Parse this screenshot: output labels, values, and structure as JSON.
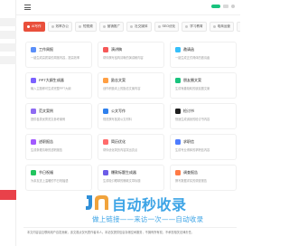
{
  "tabs": [
    {
      "label": "AI写作"
    },
    {
      "label": "效率办公"
    },
    {
      "label": "短视频"
    },
    {
      "label": "营销推广"
    },
    {
      "label": "社交媒体"
    },
    {
      "label": "SEO优化"
    },
    {
      "label": "学习教育"
    },
    {
      "label": "电商运营"
    },
    {
      "label": "生活助手"
    }
  ],
  "cards": [
    {
      "title": "工作周报",
      "desc": "一键生成高质量的周报内容，提高效率",
      "icon": "report-icon",
      "color": "#5b8ff9"
    },
    {
      "title": "演讲稿",
      "desc": "帮你撰写结构清晰的演讲稿内容",
      "icon": "speech-icon",
      "color": "#f65858"
    },
    {
      "title": "邀请函",
      "desc": "一键生成正式得体的邀请函",
      "icon": "invite-icon",
      "color": "#36bffa"
    },
    {
      "title": "PPT大纲生成器",
      "desc": "输入主题即可生成完整PPT大纲",
      "icon": "ppt-icon",
      "color": "#7b61ff"
    },
    {
      "title": "励志文案",
      "desc": "创作积极向上的励志文案内容",
      "icon": "motivation-icon",
      "color": "#ff9f43"
    },
    {
      "title": "朋友圈文案",
      "desc": "生成有趣吸睛的朋友圈文案",
      "icon": "moments-icon",
      "color": "#19c37d"
    },
    {
      "title": "范文案例",
      "desc": "提供各类优秀范文参考案例",
      "icon": "sample-icon",
      "color": "#8e6bf2"
    },
    {
      "title": "公文写作",
      "desc": "规范撰写各类公文材料",
      "icon": "official-icon",
      "color": "#2f80ed"
    },
    {
      "title": "检讨书",
      "desc": "快速生成诚恳的检讨书内容",
      "icon": "review-icon",
      "color": "#1f1f1f"
    },
    {
      "title": "述职报告",
      "desc": "生成条理清晰的述职报告",
      "icon": "duty-icon",
      "color": "#a259ff"
    },
    {
      "title": "简历优化",
      "desc": "帮你优化简历内容突出亮点",
      "icon": "resume-icon",
      "color": "#ff6b6b"
    },
    {
      "title": "求职信",
      "desc": "生成专业得体的求职信内容",
      "icon": "cover-letter-icon",
      "color": "#4d7cfe"
    },
    {
      "title": "节日祝福",
      "desc": "为亲友送上温暖的节日祝福语",
      "icon": "holiday-icon",
      "color": "#22c55e"
    },
    {
      "title": "爆款标题生成器",
      "desc": "生成吸引眼球的爆款文章标题",
      "icon": "headline-icon",
      "color": "#6c5ce7"
    },
    {
      "title": "调查报告",
      "desc": "撰写数据详实的调查报告",
      "icon": "survey-icon",
      "color": "#ff7a45"
    }
  ],
  "footer": {
    "text": "本文内容由互联网用户自发贡献，该文观点仅代表作者本人。本站仅提供信息存储空间服务，不拥有所有权，不承担相关法律责任。"
  },
  "watermark": {
    "title": "自动秒收录",
    "subtitle": "做上链接——来访一次——自动收录"
  }
}
